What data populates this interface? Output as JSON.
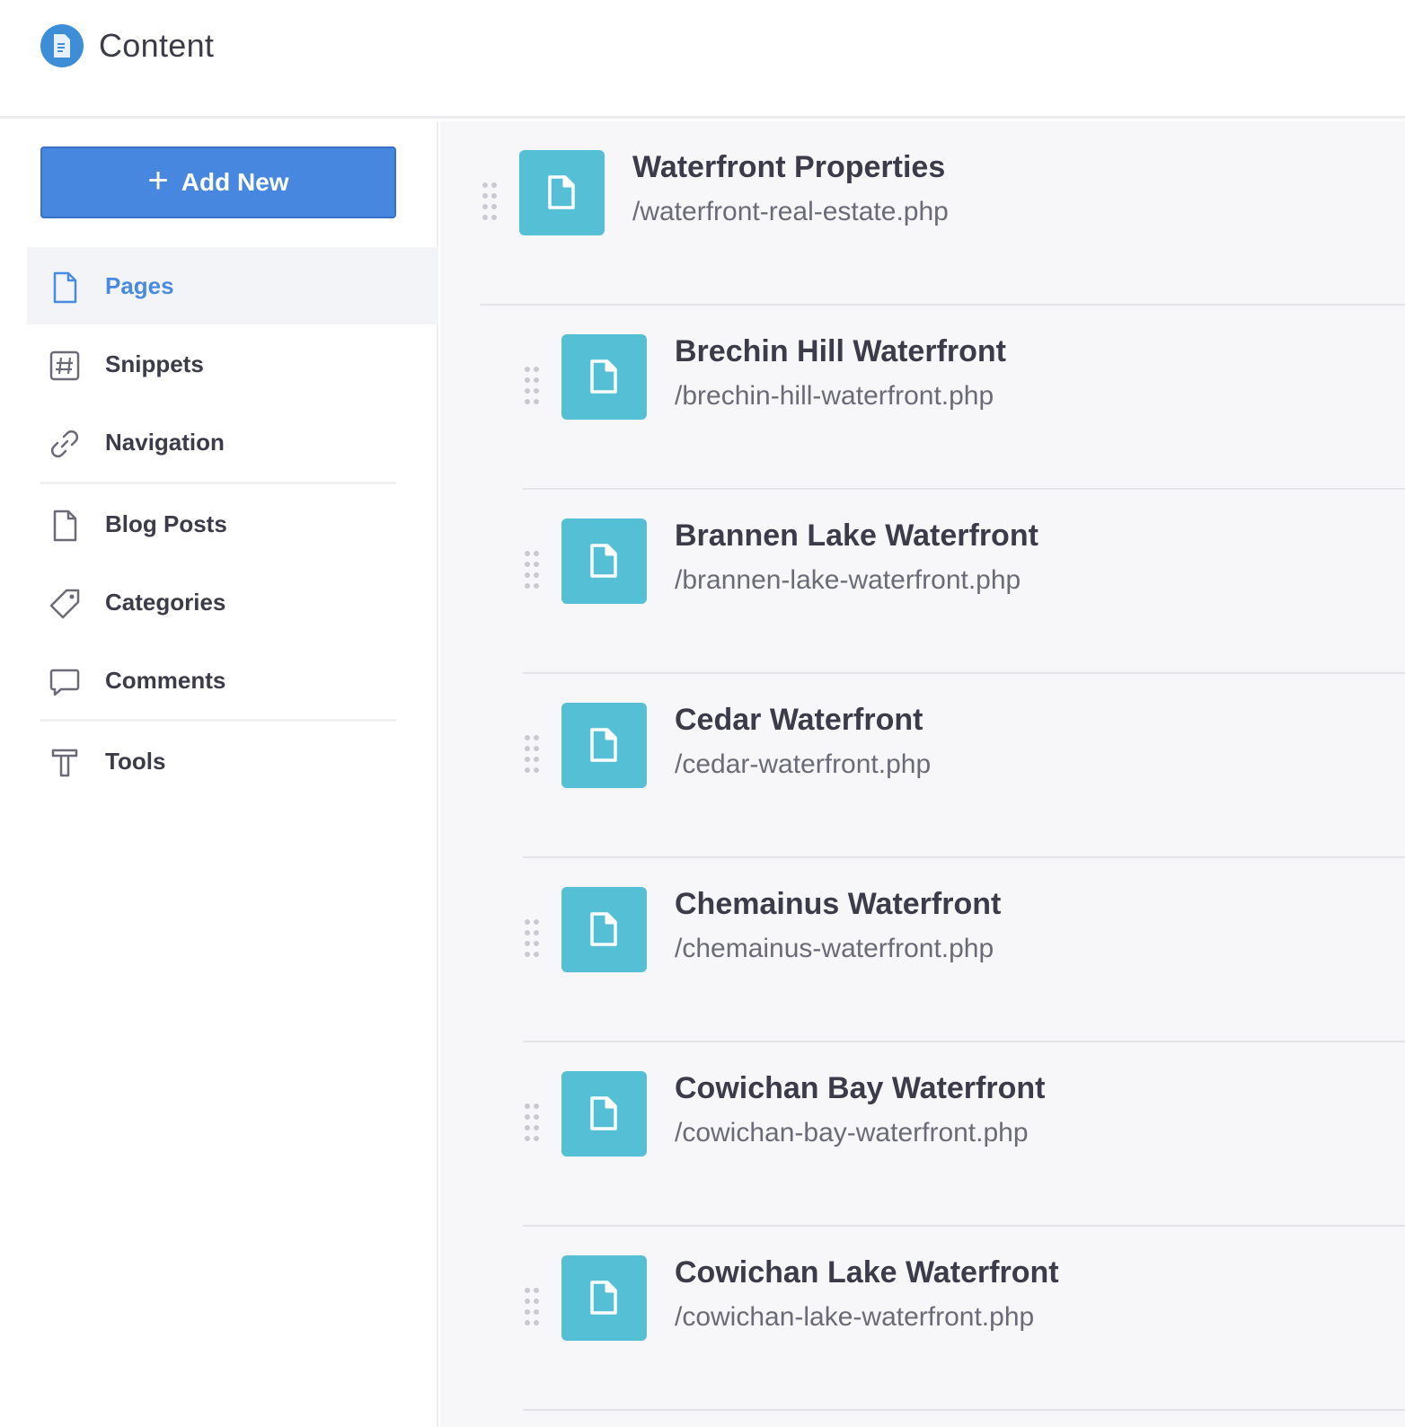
{
  "header": {
    "title": "Content",
    "logo_icon": "document-icon"
  },
  "sidebar": {
    "add_button": {
      "label": "Add New",
      "icon": "plus-icon"
    },
    "items": [
      {
        "id": "pages",
        "label": "Pages",
        "icon": "page-icon",
        "active": true
      },
      {
        "id": "snippets",
        "label": "Snippets",
        "icon": "hash-icon",
        "active": false
      },
      {
        "id": "navigation",
        "label": "Navigation",
        "icon": "link-icon",
        "active": false
      },
      {
        "id": "blog-posts",
        "label": "Blog Posts",
        "icon": "page-icon",
        "active": false
      },
      {
        "id": "categories",
        "label": "Categories",
        "icon": "tag-icon",
        "active": false
      },
      {
        "id": "comments",
        "label": "Comments",
        "icon": "comment-icon",
        "active": false
      },
      {
        "id": "tools",
        "label": "Tools",
        "icon": "tools-icon",
        "active": false
      }
    ]
  },
  "pages": [
    {
      "title": "Waterfront Properties",
      "path": "/waterfront-real-estate.php",
      "level": 0
    },
    {
      "title": "Brechin Hill Waterfront",
      "path": "/brechin-hill-waterfront.php",
      "level": 1
    },
    {
      "title": "Brannen Lake Waterfront",
      "path": "/brannen-lake-waterfront.php",
      "level": 1
    },
    {
      "title": "Cedar Waterfront",
      "path": "/cedar-waterfront.php",
      "level": 1
    },
    {
      "title": "Chemainus Waterfront",
      "path": "/chemainus-waterfront.php",
      "level": 1
    },
    {
      "title": "Cowichan Bay Waterfront",
      "path": "/cowichan-bay-waterfront.php",
      "level": 1
    },
    {
      "title": "Cowichan Lake Waterfront",
      "path": "/cowichan-lake-waterfront.php",
      "level": 1
    }
  ],
  "colors": {
    "accent": "#4787e0",
    "active_text": "#4a8ae0",
    "file_tile": "#55bfd5",
    "logo": "#3d8ed6"
  }
}
